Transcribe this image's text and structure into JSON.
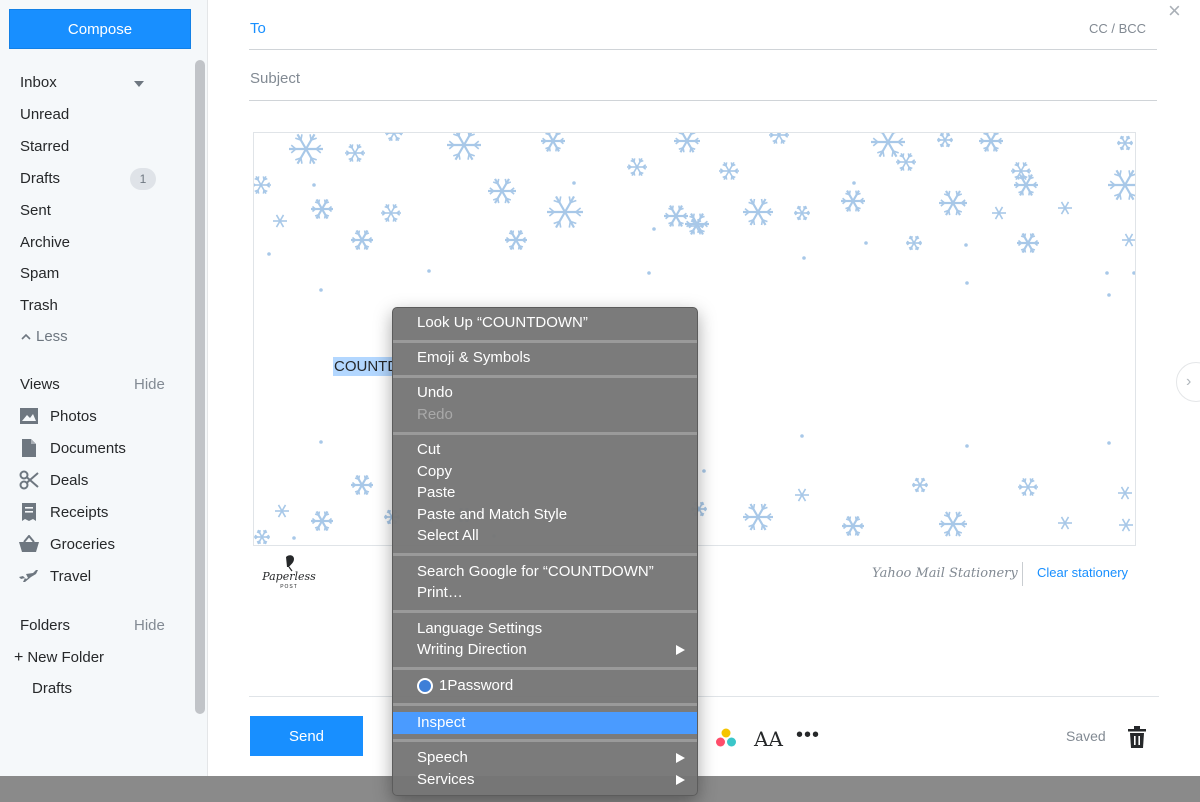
{
  "compose_label": "Compose",
  "nav": [
    {
      "label": "Inbox"
    },
    {
      "label": "Unread"
    },
    {
      "label": "Starred"
    },
    {
      "label": "Drafts",
      "count": "1"
    },
    {
      "label": "Sent"
    },
    {
      "label": "Archive"
    },
    {
      "label": "Spam"
    },
    {
      "label": "Trash"
    }
  ],
  "less_label": "Less",
  "views": {
    "title": "Views",
    "hide": "Hide",
    "items": [
      {
        "label": "Photos",
        "icon": "photos-icon"
      },
      {
        "label": "Documents",
        "icon": "documents-icon"
      },
      {
        "label": "Deals",
        "icon": "scissors-icon"
      },
      {
        "label": "Receipts",
        "icon": "receipt-icon"
      },
      {
        "label": "Groceries",
        "icon": "basket-icon"
      },
      {
        "label": "Travel",
        "icon": "plane-icon"
      }
    ]
  },
  "folders": {
    "title": "Folders",
    "hide": "Hide",
    "new_folder": "New Folder",
    "items": [
      {
        "label": "Drafts"
      }
    ]
  },
  "compose": {
    "to_label": "To",
    "cc_bcc": "CC / BCC",
    "subject_placeholder": "Subject",
    "body_text": "COUNTDOWN",
    "stationery_name": "Yahoo Mail Stationery",
    "clear_stationery": "Clear stationery",
    "send_label": "Send",
    "font_icon_text": "AA",
    "saved_label": "Saved",
    "paperless_logo": "Paperless Post"
  },
  "context_menu": {
    "items": [
      {
        "label": "Look Up “COUNTDOWN”",
        "disabled": false
      },
      {
        "label": "Emoji & Symbols",
        "disabled": false
      },
      {
        "label": "Undo",
        "disabled": false
      },
      {
        "label": "Redo",
        "disabled": true
      },
      {
        "label": "Cut",
        "disabled": false
      },
      {
        "label": "Copy",
        "disabled": false
      },
      {
        "label": "Paste",
        "disabled": false
      },
      {
        "label": "Paste and Match Style",
        "disabled": false
      },
      {
        "label": "Select All",
        "disabled": false
      },
      {
        "label": "Search Google for “COUNTDOWN”",
        "disabled": false
      },
      {
        "label": "Print…",
        "disabled": false
      },
      {
        "label": "Language Settings",
        "disabled": false
      },
      {
        "label": "Writing Direction",
        "disabled": false,
        "submenu": true
      },
      {
        "label": "1Password",
        "disabled": false,
        "icon": "onepassword-icon"
      },
      {
        "label": "Inspect",
        "disabled": false,
        "highlighted": true
      },
      {
        "label": "Speech",
        "disabled": false,
        "submenu": true
      },
      {
        "label": "Services",
        "disabled": false,
        "submenu": true
      }
    ]
  },
  "colors": {
    "accent": "#188fff",
    "snowflake": "#a8c8e8",
    "menu_highlight": "#4a9bff"
  }
}
